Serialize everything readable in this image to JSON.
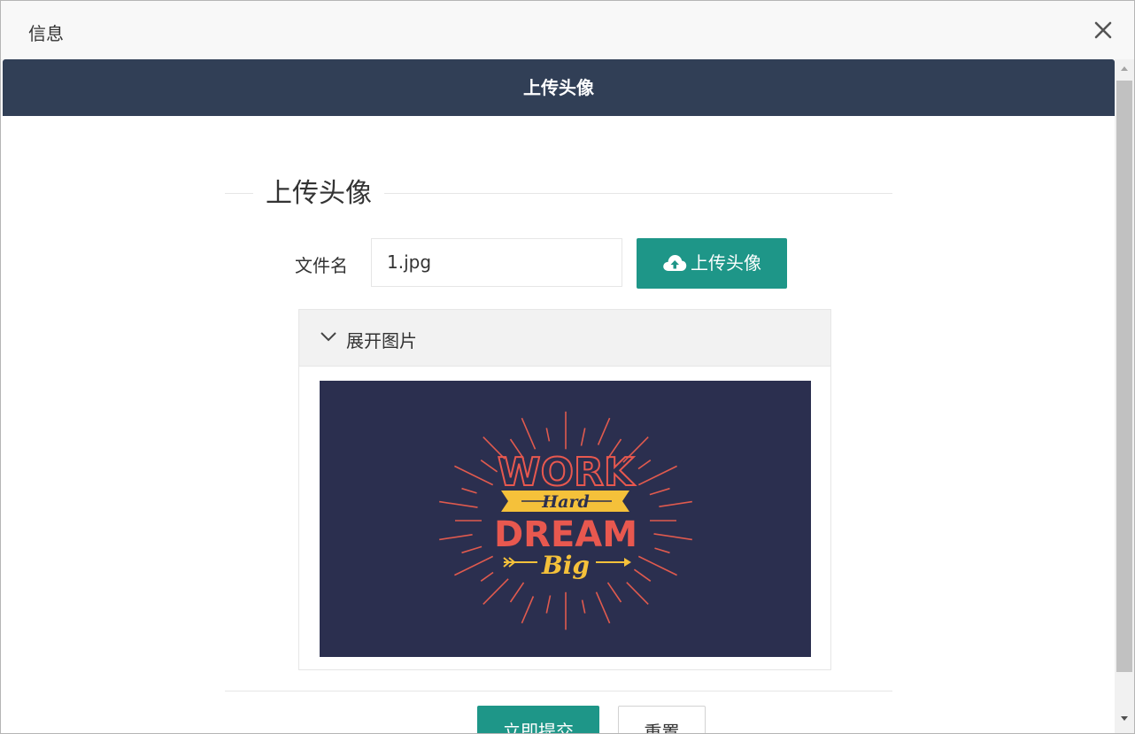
{
  "dialog": {
    "title": "信息",
    "close_icon": "close-icon"
  },
  "banner": {
    "title": "上传头像"
  },
  "form": {
    "section_title": "上传头像",
    "file_label": "文件名",
    "file_value": "1.jpg",
    "upload_button_label": "上传头像",
    "upload_icon": "cloud-upload-icon"
  },
  "collapse": {
    "title": "展开图片",
    "chevron_icon": "chevron-down-icon"
  },
  "preview_image": {
    "line1": "WORK",
    "line2": "Hard",
    "line3": "DREAM",
    "line4": "Big"
  },
  "actions": {
    "submit_label": "立即提交",
    "reset_label": "重置"
  },
  "colors": {
    "header_bar": "#313f56",
    "accent": "#1e9688",
    "preview_bg": "#2b2f4f"
  }
}
